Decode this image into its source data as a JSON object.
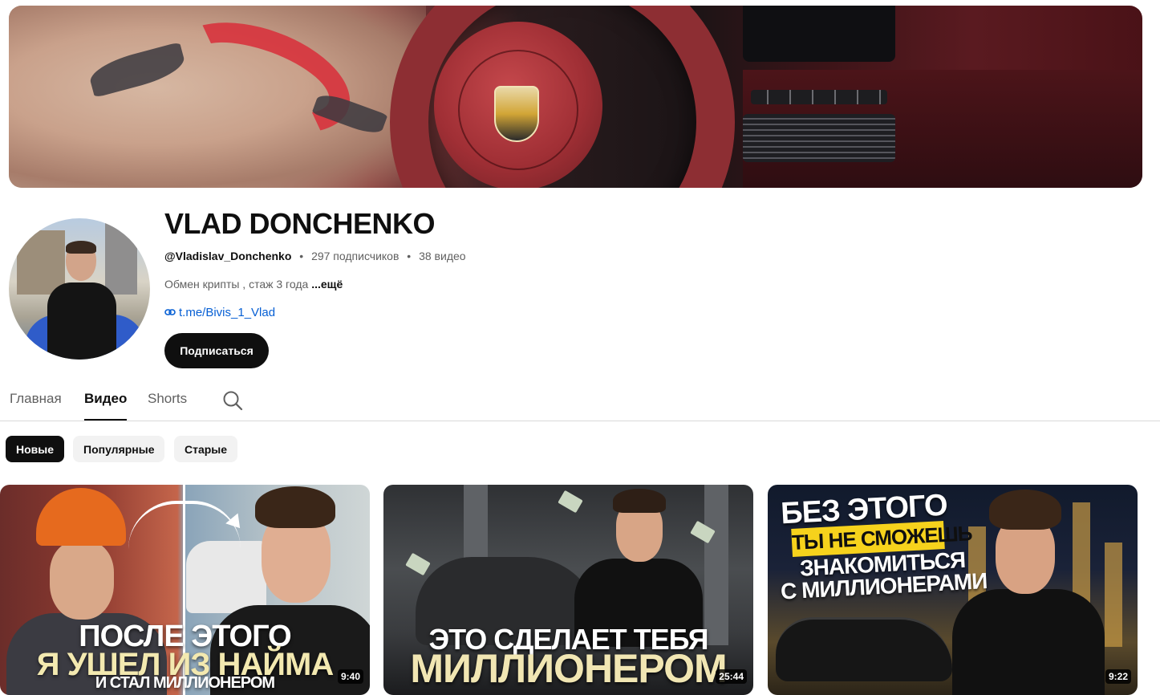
{
  "channel": {
    "name": "VLAD DONCHENKO",
    "handle": "@Vladislav_Donchenko",
    "separator": "•",
    "subscribers": "297 подписчиков",
    "video_count": "38 видео",
    "description": "Обмен крипты , стаж 3 года ",
    "description_more": "...ещё",
    "link": "t.me/Bivis_1_Vlad",
    "subscribe_label": "Подписаться"
  },
  "tabs": [
    {
      "label": "Главная",
      "active": false
    },
    {
      "label": "Видео",
      "active": true
    },
    {
      "label": "Shorts",
      "active": false
    }
  ],
  "tab_search_icon": "search-icon",
  "filter_chips": [
    {
      "label": "Новые",
      "active": true
    },
    {
      "label": "Популярные",
      "active": false
    },
    {
      "label": "Старые",
      "active": false
    }
  ],
  "videos": [
    {
      "thumbnail_lines": [
        "ПОСЛЕ ЭТОГО",
        "Я УШЕЛ ИЗ НАЙМА",
        "И СТАЛ МИЛЛИОНЕРОМ"
      ],
      "duration": "9:40"
    },
    {
      "thumbnail_lines": [
        "ЭТО СДЕЛАЕТ ТЕБЯ",
        "МИЛЛИОНЕРОМ"
      ],
      "duration": "25:44"
    },
    {
      "thumbnail_lines": [
        "БЕЗ ЭТОГО",
        "ТЫ НЕ СМОЖЕШЬ",
        "ЗНАКОМИТЬСЯ",
        "С МИЛЛИОНЕРАМИ"
      ],
      "duration": "9:22"
    }
  ],
  "colors": {
    "accent_link": "#065fd4",
    "subscribe_bg": "#0f0f0f",
    "chip_active_bg": "#0f0f0f",
    "chip_bg": "#f2f2f2"
  }
}
